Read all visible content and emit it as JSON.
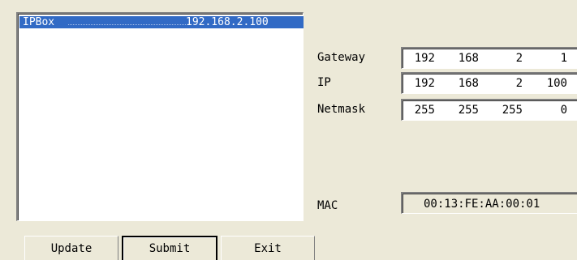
{
  "device_list": {
    "items": [
      {
        "name": "IPBox",
        "ip": "192.168.2.100",
        "selected": true
      }
    ]
  },
  "fields": {
    "gateway": {
      "label": "Gateway",
      "octets": [
        "192",
        "168",
        "2",
        "1"
      ]
    },
    "ip": {
      "label": "IP",
      "octets": [
        "192",
        "168",
        "2",
        "100"
      ]
    },
    "netmask": {
      "label": "Netmask",
      "octets": [
        "255",
        "255",
        "255",
        "0"
      ]
    },
    "mac": {
      "label": "MAC",
      "value": "00:13:FE:AA:00:01"
    }
  },
  "buttons": {
    "update": "Update",
    "submit": "Submit",
    "exit": "Exit"
  },
  "colors": {
    "window_bg": "#ece9d8",
    "selection": "#316ac5"
  }
}
